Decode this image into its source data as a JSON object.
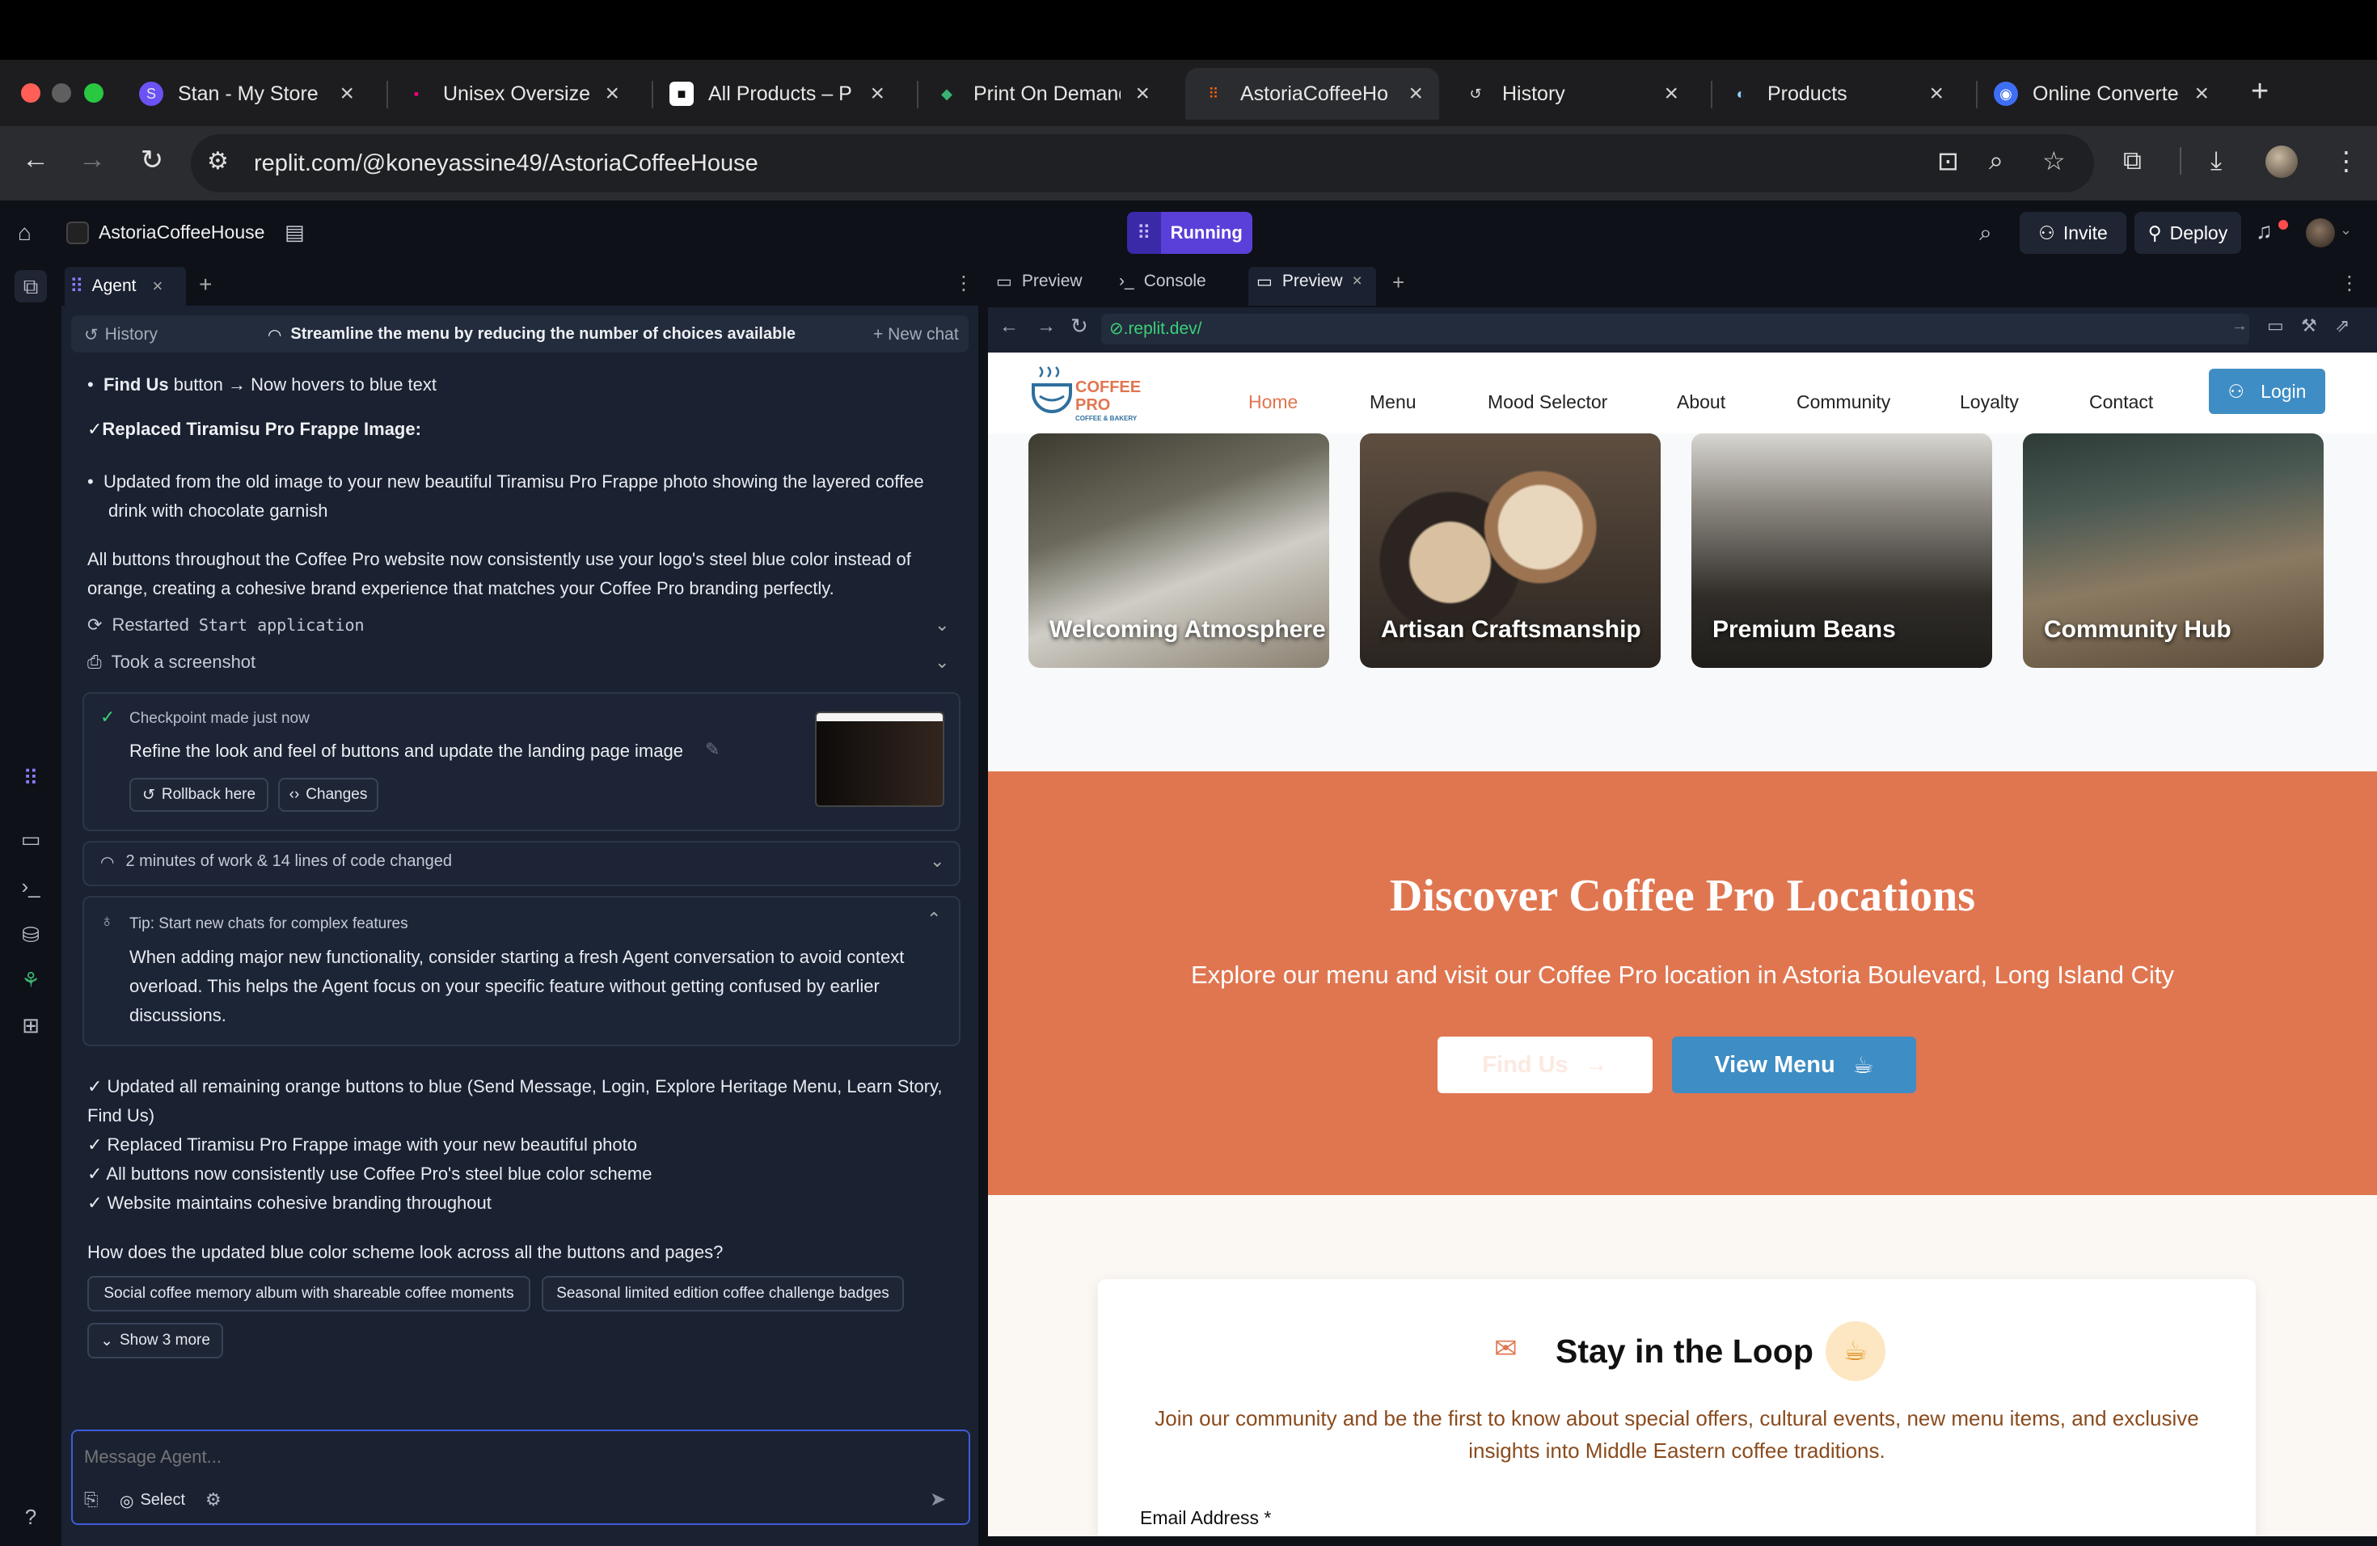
{
  "browser": {
    "tabs": [
      {
        "label": "Stan - My Store",
        "icon": "S"
      },
      {
        "label": "Unisex Oversize",
        "icon": "▪"
      },
      {
        "label": "All Products – P",
        "icon": "■"
      },
      {
        "label": "Print On Demand",
        "icon": "◆"
      },
      {
        "label": "AstoriaCoffeeHo",
        "icon": "⠿"
      },
      {
        "label": "History",
        "icon": "↺"
      },
      {
        "label": "Products",
        "icon": "◐"
      },
      {
        "label": "Online Converte",
        "icon": "◉"
      }
    ],
    "close_glyph": "×",
    "new_tab": "+",
    "url": "replit.com/@koneyassine49/AstoriaCoffeeHouse"
  },
  "replit": {
    "project_name": "AstoriaCoffeeHouse",
    "status": "Running",
    "invite": "Invite",
    "deploy": "Deploy"
  },
  "agent": {
    "tab_label": "Agent",
    "history": "History",
    "chat_title": "Streamline the menu by reducing the number of choices available",
    "new_chat": "New chat",
    "find_us_bold": "Find Us",
    "find_us_rest": " button → Now hovers to blue text",
    "replaced_heading": "✓Replaced Tiramisu Pro Frappe Image:",
    "replaced_line1": "Updated from the old image to your new beautiful Tiramisu Pro Frappe photo showing the layered coffee",
    "replaced_line2": "drink with chocolate garnish",
    "summary_line1": "All buttons throughout the Coffee Pro website now consistently use your logo's steel blue color instead of",
    "summary_line2": "orange, creating a cohesive brand experience that matches your Coffee Pro branding perfectly.",
    "restarted_prefix": "Restarted",
    "restarted_code": "Start application",
    "screenshot": "Took a screenshot",
    "checkpoint_label": "Checkpoint made just now",
    "checkpoint_text": "Refine the look and feel of buttons and update the landing page image",
    "rollback": "Rollback here",
    "changes": "Changes",
    "work_summary": "2 minutes of work & 14 lines of code changed",
    "tip_title": "Tip: Start new chats for complex features",
    "tip_line1": "When adding major new functionality, consider starting a fresh Agent conversation to avoid context",
    "tip_line2": "overload. This helps the Agent focus on your specific feature without getting confused by earlier",
    "tip_line3": "discussions.",
    "check1a": "✓ Updated all remaining orange buttons to blue (Send Message, Login, Explore Heritage Menu, Learn Story,",
    "check1b": "Find Us)",
    "check2": "✓ Replaced Tiramisu Pro Frappe image with your new beautiful photo",
    "check3": "✓ All buttons now consistently use Coffee Pro's steel blue color scheme",
    "check4": "✓ Website maintains cohesive branding throughout",
    "question": "How does the updated blue color scheme look across all the buttons and pages?",
    "suggestion1": "Social coffee memory album with shareable coffee moments",
    "suggestion2": "Seasonal limited edition coffee challenge badges",
    "show_more": "Show 3 more",
    "input_placeholder": "Message Agent...",
    "select": "Select"
  },
  "preview": {
    "tab1": "Preview",
    "tab2": "Console",
    "tab3": "Preview",
    "url": ".replit.dev/"
  },
  "site": {
    "logo_line1": "COFFEE",
    "logo_line2": "PRO",
    "logo_tag": "COFFEE & BAKERY",
    "nav": [
      "Home",
      "Menu",
      "Mood Selector",
      "About",
      "Community",
      "Loyalty",
      "Contact"
    ],
    "login": "Login",
    "photos": [
      "Welcoming Atmosphere",
      "Artisan Craftsmanship",
      "Premium Beans",
      "Community Hub"
    ],
    "discover_title": "Discover Coffee Pro Locations",
    "discover_sub": "Explore our menu and visit our Coffee Pro location in Astoria Boulevard, Long Island City",
    "find_us": "Find Us",
    "view_menu": "View Menu",
    "loop_title": "Stay in the Loop",
    "loop_line1": "Join our community and be the first to know about special offers, cultural events, new menu items, and exclusive",
    "loop_line2": "insights into Middle Eastern coffee traditions.",
    "email_label": "Email Address *"
  },
  "colors": {
    "accent_orange": "#e07650",
    "steel_blue": "#3e8dc4",
    "running": "#5b3fd9"
  }
}
